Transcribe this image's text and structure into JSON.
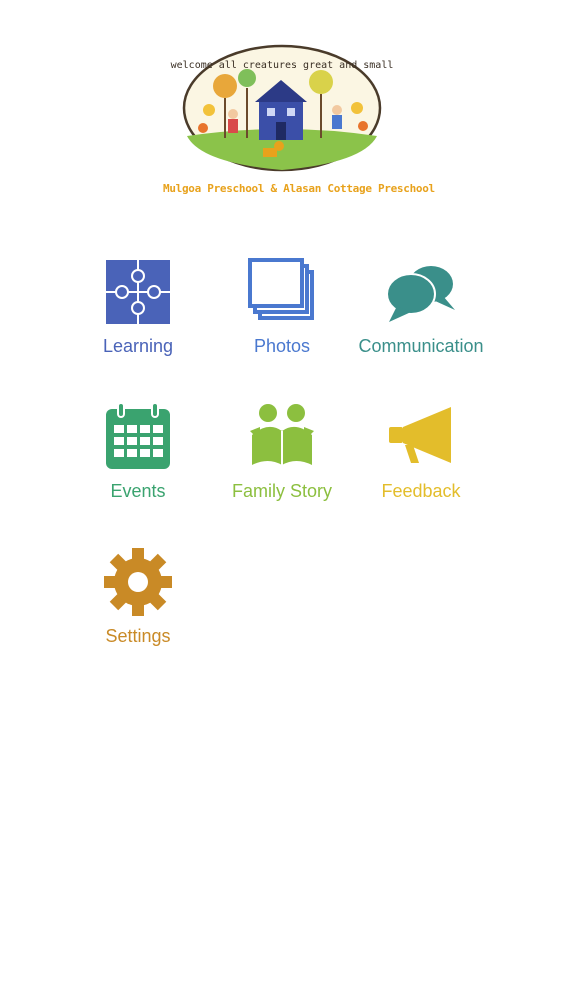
{
  "header": {
    "logo_text_top": "welcome all creatures great and small",
    "logo_caption": "Mulgoa Preschool & Alasan Cottage Preschool"
  },
  "menu": [
    {
      "id": "learning",
      "label": "Learning",
      "color": "#4a63b8",
      "icon": "puzzle-icon"
    },
    {
      "id": "photos",
      "label": "Photos",
      "color": "#4a78cf",
      "icon": "photos-icon"
    },
    {
      "id": "communication",
      "label": "Communication",
      "color": "#3a8f8a",
      "icon": "chat-bubbles-icon"
    },
    {
      "id": "events",
      "label": "Events",
      "color": "#3aa36f",
      "icon": "calendar-icon"
    },
    {
      "id": "family_story",
      "label": "Family Story",
      "color": "#8cbf3f",
      "icon": "family-reading-icon"
    },
    {
      "id": "feedback",
      "label": "Feedback",
      "color": "#e3bd2b",
      "icon": "megaphone-icon"
    },
    {
      "id": "settings",
      "label": "Settings",
      "color": "#c98a26",
      "icon": "gear-icon"
    }
  ]
}
